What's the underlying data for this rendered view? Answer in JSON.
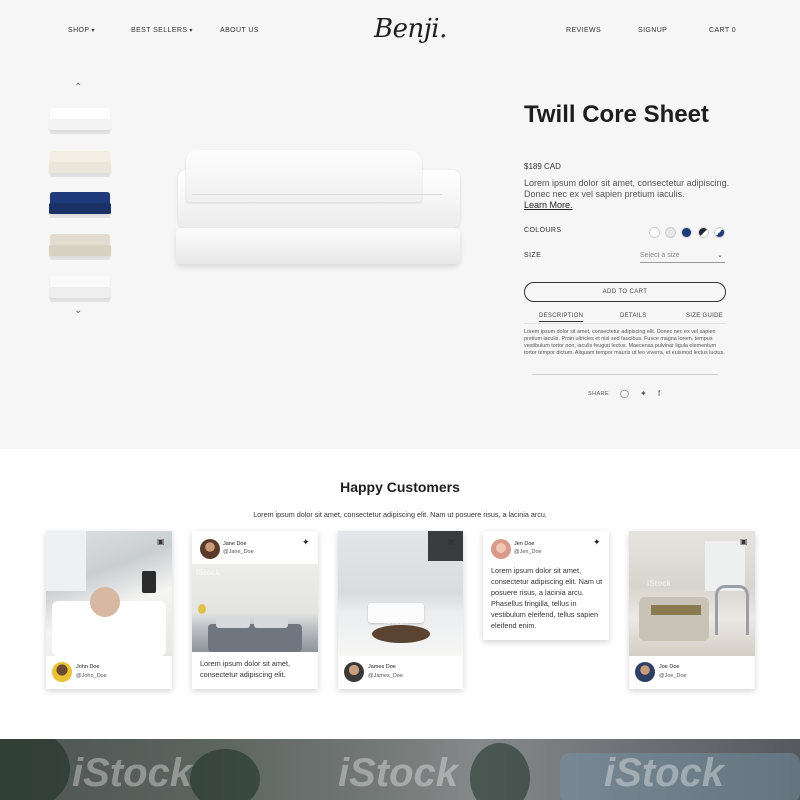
{
  "header": {
    "logo": "Benji.",
    "nav_left": [
      {
        "label": "SHOP",
        "has_dropdown": true
      },
      {
        "label": "BEST SELLERS",
        "has_dropdown": true
      },
      {
        "label": "ABOUT US",
        "has_dropdown": false
      }
    ],
    "nav_right": [
      {
        "label": "REVIEWS"
      },
      {
        "label": "SIGNUP"
      },
      {
        "label": "CART 0"
      }
    ]
  },
  "product": {
    "title": "Twill Core Sheet",
    "price": "$189 CAD",
    "description": "Lorem ipsum dolor sit amet, consectetur adipiscing. Donec nec ex vel sapien pretium iaculis.",
    "learn_more": "Learn More.",
    "colours_label": "COLOURS",
    "size_label": "SIZE",
    "size_placeholder": "Select a size",
    "add_to_cart": "ADD TO CART",
    "colours": [
      "#ffffff",
      "#e6e6e6",
      "#1f3a7a",
      "#1e2433",
      "#f2f2f2"
    ],
    "thumbnails": [
      {
        "top": "#ffffff",
        "bottom": "#f3f3f3"
      },
      {
        "top": "#f2eee4",
        "bottom": "#ebe6da"
      },
      {
        "top": "#1f3a7a",
        "bottom": "#1a3166"
      },
      {
        "top": "#e2ddd0",
        "bottom": "#d8d2c3"
      },
      {
        "top": "#fafafa",
        "bottom": "#eeeeee"
      }
    ],
    "tabs": [
      "DESCRIPTION",
      "DETAILS",
      "SIZE GUIDE"
    ],
    "tab_body": "Lorem ipsum dolor sit amet, consectetur adipiscing elit. Donec nec ex vel sapien pretium iaculis. Proin ultricies et nisl sed faucibus. Fusce magna lorem, tempus vestibulum tortor non, iaculis feugiat lectus. Maecenas pulvinar ligula elementum tortor tempor dictum. Aliquam tempor mauris ut leo viverra, et euismod lectus luctus.",
    "share_label": "SHARE"
  },
  "customers": {
    "title": "Happy Customers",
    "subtitle": "Lorem ipsum dolor sit amet, consectetur adipiscing elit. Nam ut posuere risus, a lacinia arcu.",
    "cards": [
      {
        "name": "John Doe",
        "handle": "@John_Doe"
      },
      {
        "name": "Jane Doe",
        "handle": "@Jane_Doe",
        "text": "Lorem ipsum dolor sit amet, consectetur adipiscing elit."
      },
      {
        "name": "James Doe",
        "handle": "@James_Doe"
      },
      {
        "name": "Jen Doe",
        "handle": "@Jen_Doe",
        "text": "Lorem ipsum dolor sit amet, consectetur adipiscing elit. Nam ut posuere risus, a lacinia arcu. Phasellus fringilla, tellus in vestibulum eleifend, tellus sapien eleifend enim."
      },
      {
        "name": "Joe Doe",
        "handle": "@Joe_Doe"
      }
    ],
    "watermark": "iStock"
  },
  "banner": {
    "watermark": "iStock"
  },
  "icons": {
    "instagram": "instagram-icon",
    "twitter": "twitter-icon",
    "facebook": "facebook-icon"
  }
}
